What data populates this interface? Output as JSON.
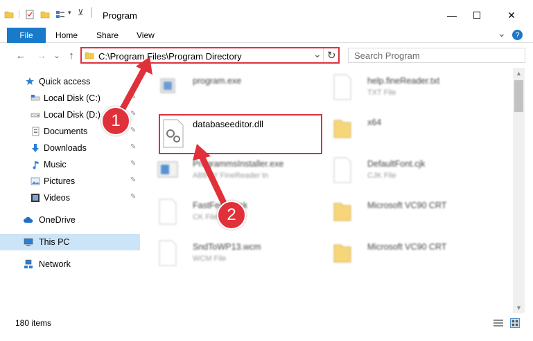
{
  "window": {
    "title": "Program",
    "minimize": "—",
    "maximize": "☐",
    "close": "✕"
  },
  "ribbon": {
    "file": "File",
    "tabs": [
      "Home",
      "Share",
      "View"
    ],
    "expand": "⌄",
    "help": "?"
  },
  "nav": {
    "back": "←",
    "forward": "→",
    "history": "⌄",
    "up": "↑"
  },
  "address": {
    "path": "C:\\Program Files\\Program Directory",
    "dropdown": "⌄",
    "refresh": "↻"
  },
  "search": {
    "placeholder": "Search Program",
    "icon": "search-icon"
  },
  "sidebar": {
    "items": [
      {
        "label": "Quick access",
        "icon": "star-icon"
      },
      {
        "label": "Local Disk (C:)",
        "icon": "drive-icon"
      },
      {
        "label": "Local Disk (D:)",
        "icon": "drive-icon"
      },
      {
        "label": "Documents",
        "icon": "documents-icon"
      },
      {
        "label": "Downloads",
        "icon": "downloads-icon"
      },
      {
        "label": "Music",
        "icon": "music-icon"
      },
      {
        "label": "Pictures",
        "icon": "pictures-icon"
      },
      {
        "label": "Videos",
        "icon": "videos-icon"
      },
      {
        "label": "OneDrive",
        "icon": "cloud-icon"
      },
      {
        "label": "This PC",
        "icon": "computer-icon"
      },
      {
        "label": "Network",
        "icon": "network-icon"
      }
    ],
    "pin_glyph": "📌"
  },
  "files": {
    "left": [
      {
        "name": "program.exe",
        "type": ""
      },
      {
        "name": "databaseeditor.dll",
        "type": ""
      },
      {
        "name": "ProgrammsInstaller.exe",
        "type": "ABBYY FineReader tn"
      },
      {
        "name": "FastFeedback",
        "type": "CK File"
      },
      {
        "name": "SndToWP13.wcm",
        "type": "WCM File"
      }
    ],
    "right": [
      {
        "name": "help.fineReader.txt",
        "type": "TXT File"
      },
      {
        "name": "x64",
        "type": ""
      },
      {
        "name": "DefaultFont.cjk",
        "type": "CJK File"
      },
      {
        "name": "Microsoft VC90 CRT",
        "type": ""
      },
      {
        "name": "Microsoft VC90 CRT",
        "type": ""
      }
    ]
  },
  "status": {
    "count": "180 items"
  },
  "annotations": {
    "step1": "1",
    "step2": "2"
  },
  "colors": {
    "accent": "#1979ca",
    "highlight": "#e0303a",
    "selection": "#cce4f7",
    "folder": "#f3c94b"
  }
}
